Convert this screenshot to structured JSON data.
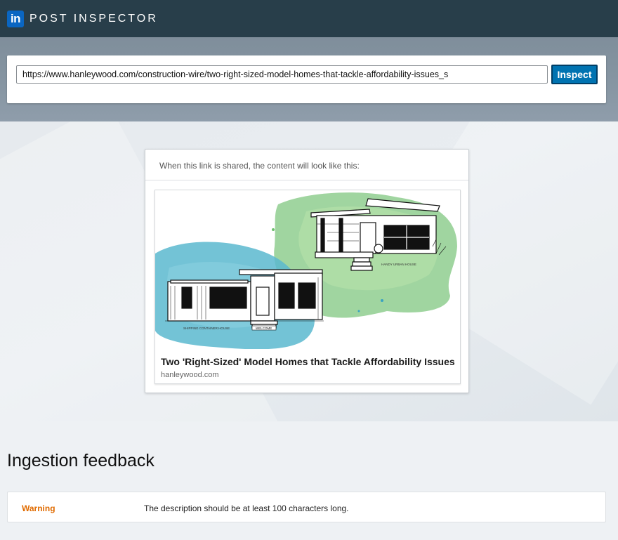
{
  "header": {
    "logo_text": "in",
    "title": "POST INSPECTOR"
  },
  "search": {
    "url_value": "https://www.hanleywood.com/construction-wire/two-right-sized-model-homes-that-tackle-affordability-issues_s",
    "button_label": "Inspect"
  },
  "preview": {
    "caption": "When this link is shared, the content will look like this:",
    "post": {
      "title": "Two 'Right-Sized' Model Homes that Tackle Affordability Issues",
      "domain": "hanleywood.com",
      "image_label_left": "SHIPPING CONTAINER HOUSE",
      "image_label_right": "HANDY URBAN HOUSE",
      "image_sign": "WELCOME"
    }
  },
  "feedback": {
    "heading": "Ingestion feedback",
    "items": [
      {
        "level": "Warning",
        "message": "The description should be at least 100 characters long."
      }
    ]
  },
  "colors": {
    "topbar": "#283e4a",
    "brand_blue": "#0073b1",
    "warning": "#e06b00",
    "watercolor_blue": "#5bb9cf",
    "watercolor_green": "#8fce8f"
  }
}
